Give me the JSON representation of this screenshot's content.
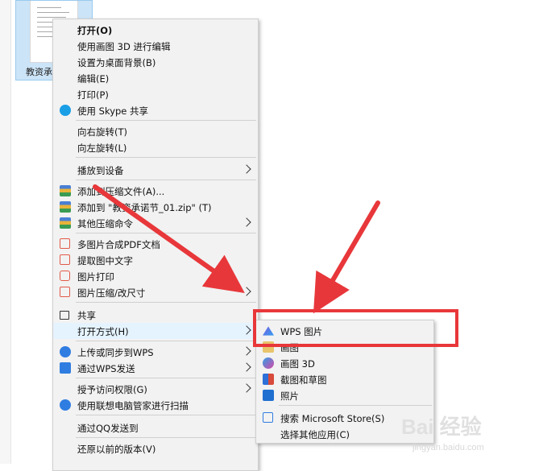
{
  "explorer": {
    "file_name": "教资承诺"
  },
  "context_menu": {
    "items": [
      {
        "label": "打开(O)",
        "bold": true
      },
      {
        "label": "使用画图 3D 进行编辑"
      },
      {
        "label": "设置为桌面背景(B)"
      },
      {
        "label": "编辑(E)"
      },
      {
        "label": "打印(P)"
      },
      {
        "label": "使用 Skype 共享",
        "icon": "skype-icon"
      },
      {
        "label": "向右旋转(T)"
      },
      {
        "label": "向左旋转(L)"
      },
      {
        "label": "播放到设备",
        "submenu": true
      },
      {
        "label": "添加到压缩文件(A)...",
        "icon": "winrar-icon"
      },
      {
        "label": "添加到 \"教资承诺节_01.zip\" (T)",
        "icon": "winrar-icon"
      },
      {
        "label": "其他压缩命令",
        "icon": "winrar-icon",
        "submenu": true
      },
      {
        "label": "多图片合成PDF文档",
        "icon": "pdf-merge-icon"
      },
      {
        "label": "提取图中文字",
        "icon": "ocr-icon"
      },
      {
        "label": "图片打印",
        "icon": "print-icon"
      },
      {
        "label": "图片压缩/改尺寸",
        "icon": "image-compress-icon",
        "submenu": true
      },
      {
        "label": "共享",
        "icon": "share-icon"
      },
      {
        "label": "打开方式(H)",
        "submenu": true
      },
      {
        "label": "上传或同步到WPS",
        "icon": "wps-cloud-icon",
        "submenu": true
      },
      {
        "label": "通过WPS发送",
        "icon": "wps-send-icon",
        "submenu": true
      },
      {
        "label": "授予访问权限(G)",
        "submenu": true
      },
      {
        "label": "使用联想电脑管家进行扫描",
        "icon": "lenovo-scan-icon"
      },
      {
        "label": "通过QQ发送到"
      },
      {
        "label": "还原以前的版本(V)"
      }
    ]
  },
  "open_with_submenu": {
    "items": [
      {
        "label": "WPS 图片",
        "icon": "wps-picture-icon"
      },
      {
        "label": "画图",
        "icon": "paint-icon"
      },
      {
        "label": "画图 3D",
        "icon": "paint3d-icon"
      },
      {
        "label": "截图和草图",
        "icon": "snip-sketch-icon"
      },
      {
        "label": "照片",
        "icon": "photos-icon"
      },
      {
        "label": "搜索 Microsoft Store(S)",
        "icon": "store-icon"
      },
      {
        "label": "选择其他应用(C)"
      }
    ]
  },
  "watermark": {
    "logo": "Bai  经验",
    "url": "jingyan.baidu.com"
  },
  "colors": {
    "annotation_red": "#e8373a",
    "menu_bg": "#f2f2f2",
    "selection": "#cce4f7"
  }
}
